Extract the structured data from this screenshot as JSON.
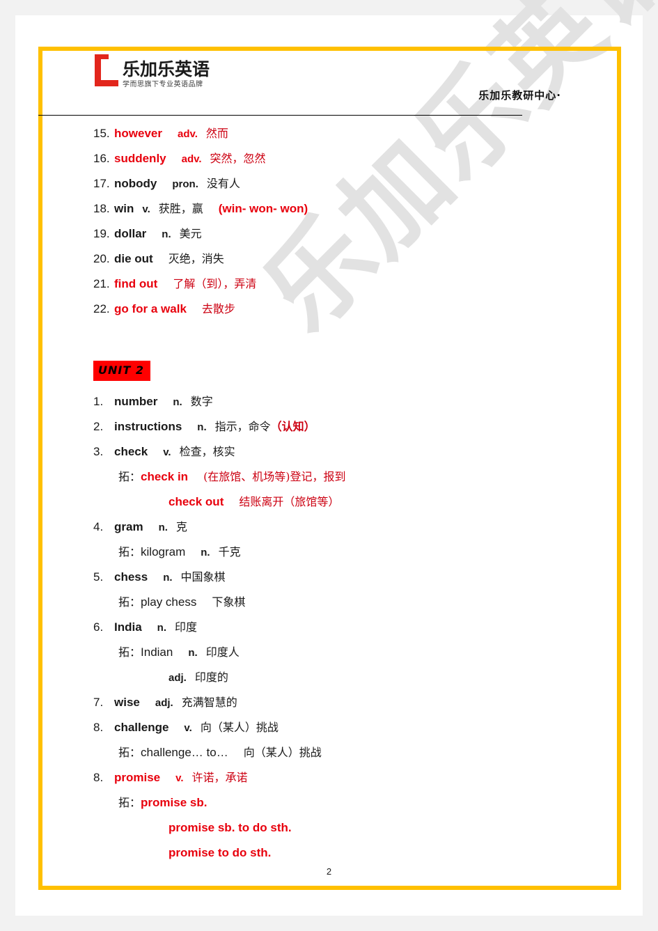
{
  "header": {
    "logo_main": "乐加乐英语",
    "logo_tagline": "学而思旗下专业英语品牌",
    "logo_letter": "L",
    "right_text": "乐加乐教研中心·"
  },
  "watermark": {
    "text": "乐加乐英语"
  },
  "page_number": "2",
  "unit_badge": {
    "label": "UNIT 2"
  },
  "unit1_tail": [
    {
      "num": "15.",
      "word": "however",
      "pos": "adv.",
      "cn": "然而",
      "color": "red"
    },
    {
      "num": "16.",
      "word": "suddenly",
      "pos": "adv.",
      "cn": "突然，忽然",
      "color": "red"
    },
    {
      "num": "17.",
      "word": "nobody",
      "pos": "pron.",
      "cn": "没有人",
      "color": "black"
    },
    {
      "num": "18.",
      "word": "win",
      "pos": "v.",
      "cn": "获胜，赢",
      "extra": "(win- won- won)",
      "color": "black"
    },
    {
      "num": "19.",
      "word": "dollar",
      "pos": "n.",
      "cn": "美元",
      "color": "black"
    },
    {
      "num": "20.",
      "word": "die out",
      "pos": "",
      "cn": "灭绝，消失",
      "color": "black"
    },
    {
      "num": "21.",
      "word": "find out",
      "pos": "",
      "cn": "了解（到），弄清",
      "color": "red"
    },
    {
      "num": "22.",
      "word": "go for a walk",
      "pos": "",
      "cn": "去散步",
      "color": "red"
    }
  ],
  "unit2": [
    {
      "num": "1.",
      "word": "number",
      "pos": "n.",
      "cn": "数字",
      "color": "black"
    },
    {
      "num": "2.",
      "word": "instructions",
      "pos": "n.",
      "cn": "指示，命令",
      "cn_red": "（认知）",
      "color": "black"
    },
    {
      "num": "3.",
      "word": "check",
      "pos": "v.",
      "cn": "检查，核实",
      "color": "black"
    },
    {
      "sub": true,
      "prefix": "拓：",
      "word": "check in",
      "pos": "",
      "cn": "(在旅馆、机场等)登记，报到",
      "color": "red"
    },
    {
      "sub": true,
      "indent2": true,
      "prefix": "",
      "word": "check out",
      "pos": "",
      "cn": "结账离开（旅馆等）",
      "color": "red"
    },
    {
      "num": "4.",
      "word": "gram",
      "pos": "n.",
      "cn": "克",
      "color": "black"
    },
    {
      "sub": true,
      "prefix": "拓：",
      "word": "kilogram",
      "pos": "n.",
      "cn": "千克",
      "color": "black"
    },
    {
      "num": "5.",
      "word": "chess",
      "pos": "n.",
      "cn": "中国象棋",
      "color": "black"
    },
    {
      "sub": true,
      "prefix": "拓：",
      "word": "play chess",
      "pos": "",
      "cn": "下象棋",
      "color": "black"
    },
    {
      "num": "6.",
      "word": "India",
      "pos": "n.",
      "cn": "印度",
      "color": "black"
    },
    {
      "sub": true,
      "prefix": "拓：",
      "word": "Indian",
      "pos": "n.",
      "cn": "印度人",
      "color": "black"
    },
    {
      "sub": true,
      "indent3": true,
      "prefix": "",
      "word": "",
      "pos": "adj.",
      "cn": "印度的",
      "color": "black"
    },
    {
      "num": "7.",
      "word": "wise",
      "pos": "adj.",
      "cn": "充满智慧的",
      "color": "black"
    },
    {
      "num": "8.",
      "word": "challenge",
      "pos": "v.",
      "cn": "向（某人）挑战",
      "color": "black"
    },
    {
      "sub": true,
      "prefix": "拓：",
      "word": "challenge… to…",
      "pos": "",
      "cn": "向（某人）挑战",
      "color": "black"
    },
    {
      "num": "8.",
      "word": "promise",
      "pos": "v.",
      "cn": "许诺，承诺",
      "color": "red"
    },
    {
      "sub": true,
      "prefix": "拓：",
      "word": "promise sb.",
      "pos": "",
      "cn": "",
      "color": "red"
    },
    {
      "sub": true,
      "indent2": true,
      "prefix": "",
      "word": "promise sb. to do sth.",
      "pos": "",
      "cn": "",
      "color": "red"
    },
    {
      "sub": true,
      "indent2": true,
      "prefix": "",
      "word": "promise to do sth.",
      "pos": "",
      "cn": "",
      "color": "red"
    }
  ]
}
